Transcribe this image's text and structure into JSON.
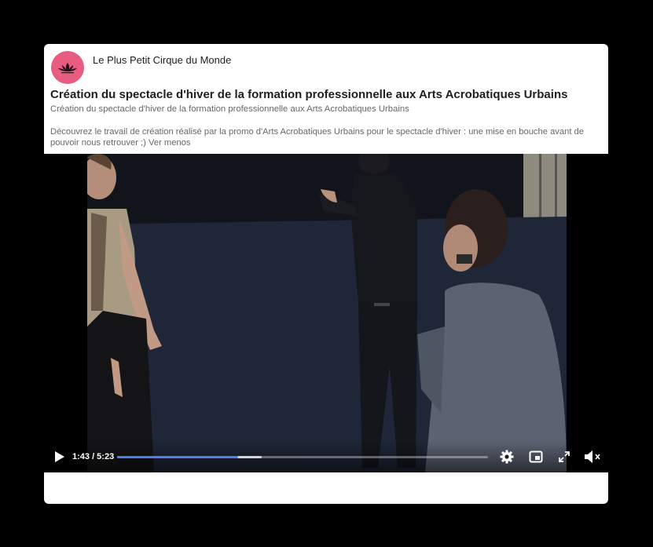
{
  "post": {
    "page_name": "Le Plus Petit Cirque du Monde",
    "title": "Création du spectacle d'hiver de la formation professionnelle aux Arts Acrobatiques Urbains",
    "subtitle": "Création du spectacle d'hiver de la formation professionnelle aux Arts Acrobatiques Urbains",
    "description": "Découvrez le travail de création réalisé par la promo d'Arts Acrobatiques Urbains pour le spectacle d'hiver : une mise en bouche avant de pouvoir nous retrouver ;)",
    "see_less_label": "Ver menos"
  },
  "video": {
    "time_display": "1:43 / 5:23",
    "played_fraction": 0.327,
    "buffered_fraction": 0.39,
    "icons": {
      "play": "play-icon",
      "settings": "gear-icon",
      "pip": "picture-in-picture-icon",
      "fullscreen": "fullscreen-icon",
      "volume": "volume-muted-icon"
    }
  },
  "colors": {
    "avatar_bg": "#e75d82",
    "progress_played": "#4c7ef0"
  }
}
